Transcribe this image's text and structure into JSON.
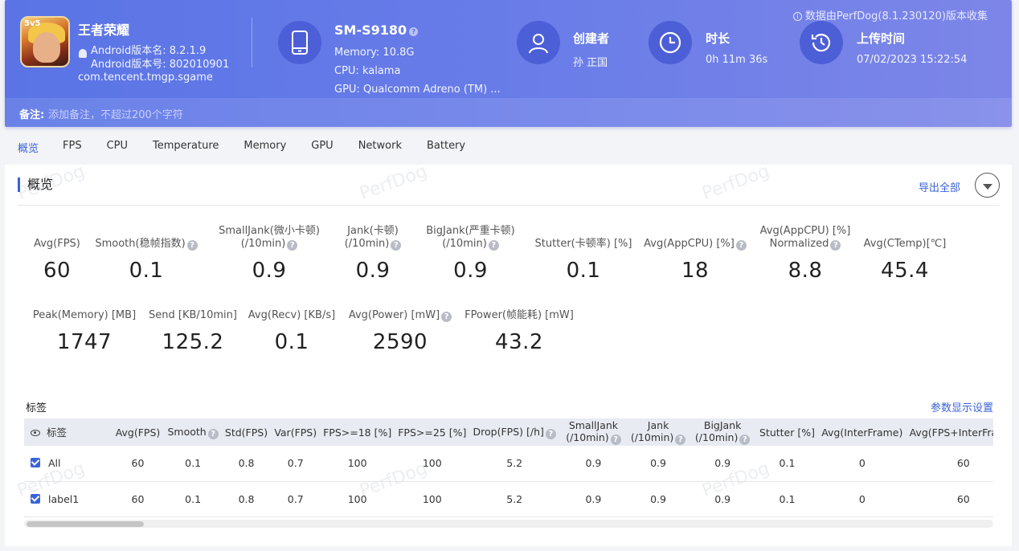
{
  "header": {
    "collect_note": "数据由PerfDog(8.1.230120)版本收集",
    "app": {
      "icon_tag": "5v5",
      "name": "王者荣耀",
      "version_name": "Android版本名: 8.2.1.9",
      "version_code": "Android版本号: 802010901",
      "package": "com.tencent.tmgp.sgame"
    },
    "device": {
      "model": "SM-S9180",
      "memory": "Memory: 10.8G",
      "cpu": "CPU: kalama",
      "gpu": "GPU: Qualcomm Adreno (TM) ..."
    },
    "creator": {
      "label": "创建者",
      "value": "孙 正国"
    },
    "duration": {
      "label": "时长",
      "value": "0h 11m 36s"
    },
    "upload": {
      "label": "上传时间",
      "value": "07/02/2023 15:22:54"
    },
    "remark": {
      "label": "备注:",
      "placeholder": "添加备注，不超过200个字符"
    }
  },
  "tabs": [
    "概览",
    "FPS",
    "CPU",
    "Temperature",
    "Memory",
    "GPU",
    "Network",
    "Battery"
  ],
  "overview": {
    "title": "概览",
    "export_label": "导出全部",
    "metrics_row1": [
      {
        "label1": "",
        "label2": "Avg(FPS)",
        "help": false,
        "value": "60"
      },
      {
        "label1": "",
        "label2": "Smooth(稳帧指数)",
        "help": true,
        "value": "0.1"
      },
      {
        "label1": "SmallJank(微小卡顿)",
        "label2": "(/10min)",
        "help": true,
        "value": "0.9"
      },
      {
        "label1": "Jank(卡顿)",
        "label2": "(/10min)",
        "help": true,
        "value": "0.9"
      },
      {
        "label1": "BigJank(严重卡顿)",
        "label2": "(/10min)",
        "help": true,
        "value": "0.9"
      },
      {
        "label1": "",
        "label2": "Stutter(卡顿率) [%]",
        "help": false,
        "value": "0.1"
      },
      {
        "label1": "",
        "label2": "Avg(AppCPU) [%]",
        "help": true,
        "value": "18"
      },
      {
        "label1": "Avg(AppCPU) [%]",
        "label2": "Normalized",
        "help": true,
        "value": "8.8"
      },
      {
        "label1": "",
        "label2": "Avg(CTemp)[℃]",
        "help": false,
        "value": "45.4"
      }
    ],
    "metrics_row2": [
      {
        "label": "Peak(Memory) [MB]",
        "help": false,
        "value": "1747"
      },
      {
        "label": "Send [KB/10min]",
        "help": false,
        "value": "125.2"
      },
      {
        "label": "Avg(Recv) [KB/s]",
        "help": false,
        "value": "0.1"
      },
      {
        "label": "Avg(Power) [mW]",
        "help": true,
        "value": "2590"
      },
      {
        "label": "FPower(帧能耗) [mW]",
        "help": false,
        "value": "43.2"
      }
    ]
  },
  "labels_section": {
    "title": "标签",
    "param_link": "参数显示设置",
    "columns": [
      {
        "l1": "标签",
        "l2": ""
      },
      {
        "l1": "Avg(FPS)",
        "l2": ""
      },
      {
        "l1": "Smooth",
        "l2": "",
        "help": true
      },
      {
        "l1": "Std(FPS)",
        "l2": ""
      },
      {
        "l1": "Var(FPS)",
        "l2": ""
      },
      {
        "l1": "FPS>=18 [%]",
        "l2": ""
      },
      {
        "l1": "FPS>=25 [%]",
        "l2": ""
      },
      {
        "l1": "Drop(FPS) [/h]",
        "l2": "",
        "help": true
      },
      {
        "l1": "SmallJank",
        "l2": "(/10min)",
        "help": true
      },
      {
        "l1": "Jank",
        "l2": "(/10min)",
        "help": true
      },
      {
        "l1": "BigJank",
        "l2": "(/10min)",
        "help": true
      },
      {
        "l1": "Stutter [%]",
        "l2": ""
      },
      {
        "l1": "Avg(InterFrame)",
        "l2": ""
      },
      {
        "l1": "Avg(FPS+InterFrame)",
        "l2": ""
      }
    ],
    "rows": [
      [
        "All",
        "60",
        "0.1",
        "0.8",
        "0.7",
        "100",
        "100",
        "5.2",
        "0.9",
        "0.9",
        "0.9",
        "0.1",
        "0",
        "60"
      ],
      [
        "label1",
        "60",
        "0.1",
        "0.8",
        "0.7",
        "100",
        "100",
        "5.2",
        "0.9",
        "0.9",
        "0.9",
        "0.1",
        "0",
        "60"
      ]
    ]
  },
  "watermark": "PerfDog"
}
